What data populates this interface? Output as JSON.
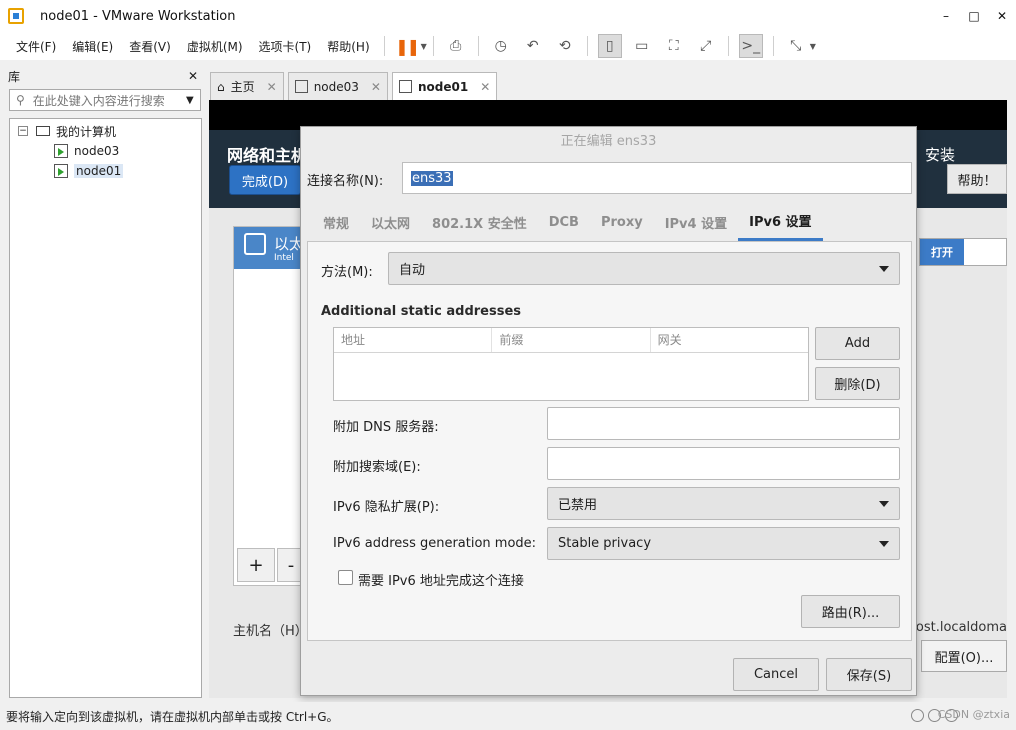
{
  "window": {
    "title": "node01 - VMware Workstation",
    "controls": [
      "–",
      "□",
      "✕"
    ]
  },
  "menu": {
    "items": [
      "文件(F)",
      "编辑(E)",
      "查看(V)",
      "虚拟机(M)",
      "选项卡(T)",
      "帮助(H)"
    ]
  },
  "toolbar": {
    "icons": [
      "pause-icon",
      "send-ctrl-alt-del-icon",
      "snapshot-icon",
      "revert-snapshot-icon",
      "snapshot-manager-icon",
      "library-view-icon",
      "single-view-icon",
      "fullscreen-icon",
      "unity-icon",
      "console-icon",
      "stretch-icon"
    ]
  },
  "library": {
    "title": "库",
    "close": "✕",
    "search_placeholder": "在此处键入内容进行搜索",
    "tree": {
      "root": "我的计算机",
      "items": [
        "node03",
        "node01"
      ],
      "selected": "node01"
    }
  },
  "tabs": [
    {
      "label": "主页",
      "active": false
    },
    {
      "label": "node03",
      "active": false
    },
    {
      "label": "node01",
      "active": true
    }
  ],
  "vm": {
    "page_title": "网络和主机",
    "done_label": "完成(D)",
    "install_label": "安装",
    "help_label": "帮助！",
    "iface_name": "以太",
    "iface_sub": "Intel",
    "toggle_on": "打开",
    "add_label": "+",
    "remove_label": "-",
    "hostname_label": "主机名（H）",
    "hostname_value": "alhost.localdoma",
    "config_label": "配置(O)..."
  },
  "dialog": {
    "title": "正在编辑 ens33",
    "conn_label": "连接名称(N):",
    "conn_value": "ens33",
    "tabs": [
      "常规",
      "以太网",
      "802.1X 安全性",
      "DCB",
      "Proxy",
      "IPv4 设置",
      "IPv6 设置"
    ],
    "active_tab": "IPv6 设置",
    "method_label": "方法(M):",
    "method_value": "自动",
    "static_title": "Additional static addresses",
    "columns": [
      "地址",
      "前缀",
      "网关"
    ],
    "add_label": "Add",
    "delete_label": "删除(D)",
    "dns_label": "附加 DNS 服务器:",
    "search_label": "附加搜索域(E):",
    "privacy_label": "IPv6 隐私扩展(P):",
    "privacy_value": "已禁用",
    "genmode_label": "IPv6 address generation mode:",
    "genmode_value": "Stable privacy",
    "require_label": "需要 IPv6 地址完成这个连接",
    "require_checked": false,
    "routes_label": "路由(R)...",
    "cancel_label": "Cancel",
    "save_label": "保存(S)"
  },
  "status": {
    "message": "要将输入定向到该虚拟机，请在虚拟机内部单击或按 Ctrl+G。",
    "watermark": "CSDN @ztxia"
  },
  "colors": {
    "accent": "#3c7bc7",
    "header_bg": "#20303e",
    "pause": "#e8650a"
  }
}
